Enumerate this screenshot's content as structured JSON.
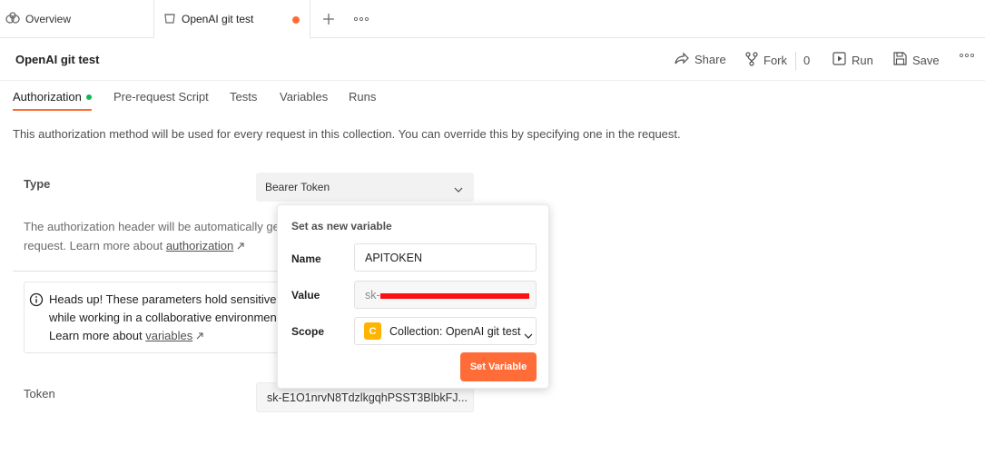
{
  "tabs": [
    {
      "label": "Overview",
      "icon": "people-icon"
    },
    {
      "label": "OpenAI git test",
      "icon": "collection-icon",
      "unsaved": true
    }
  ],
  "header": {
    "title": "OpenAI git test",
    "share_label": "Share",
    "fork_label": "Fork",
    "fork_count": "0",
    "run_label": "Run",
    "save_label": "Save"
  },
  "subtabs": [
    "Authorization",
    "Pre-request Script",
    "Tests",
    "Variables",
    "Runs"
  ],
  "description": "This authorization method will be used for every request in this collection. You can override this by specifying one in the request.",
  "auth": {
    "type_label": "Type",
    "type_value": "Bearer Token",
    "help_line1": "The authorization header will be automatically ge",
    "help_line2": "request. Learn more about ",
    "help_link": "authorization",
    "notice_line1": "Heads up! These parameters hold sensitive d",
    "notice_line2": "while working in a collaborative environment",
    "notice_line3": "Learn more about ",
    "notice_link": "variables",
    "token_label": "Token",
    "token_value": "sk-E1O1nrvN8TdzlkgqhPSST3BlbkFJ..."
  },
  "popup": {
    "title": "Set as new variable",
    "name_label": "Name",
    "name_value": "APITOKEN",
    "value_label": "Value",
    "value_prefix": "sk-",
    "scope_label": "Scope",
    "scope_badge": "C",
    "scope_value": "Collection: OpenAI git test",
    "button_label": "Set Variable"
  },
  "colors": {
    "accent": "#ff6c37",
    "success": "#0cbb52",
    "badge": "#ffb400",
    "redaction": "#ff1010"
  }
}
